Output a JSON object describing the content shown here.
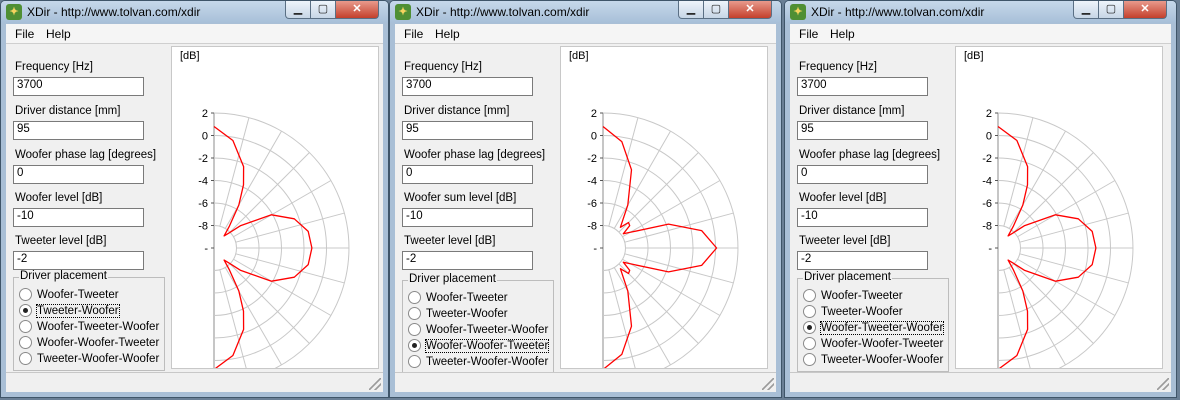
{
  "windows": [
    {
      "title": "XDir - http://www.tolvan.com/xdir",
      "menu": [
        "File",
        "Help"
      ],
      "fields": [
        {
          "label": "Frequency [Hz]",
          "value": "3700"
        },
        {
          "label": "Driver distance [mm]",
          "value": "95"
        },
        {
          "label": "Woofer phase lag [degrees]",
          "value": "0"
        },
        {
          "label": "Woofer level [dB]",
          "value": "-10"
        },
        {
          "label": "Tweeter level [dB]",
          "value": "-2"
        }
      ],
      "placement": {
        "label": "Driver placement",
        "options": [
          "Woofer-Tweeter",
          "Tweeter-Woofer",
          "Woofer-Tweeter-Woofer",
          "Woofer-Woofer-Tweeter",
          "Tweeter-Woofer-Woofer"
        ],
        "selected": 1
      },
      "chart_data": {
        "type": "line",
        "title": "",
        "ylabel": "[dB]",
        "radial_ticks": [
          "2",
          "0",
          "-2",
          "-4",
          "-6",
          "-8",
          "-"
        ],
        "r_range": [
          -10,
          2
        ],
        "angle_range_deg": [
          -90,
          90
        ],
        "grid": true,
        "series": [
          {
            "color": "#ff0000",
            "points": [
              [
                90,
                0.8
              ],
              [
                80,
                -0.3
              ],
              [
                70,
                -2.3
              ],
              [
                65,
                -3.8
              ],
              [
                60,
                -5.6
              ],
              [
                55,
                -7.6
              ],
              [
                50,
                -8.6
              ],
              [
                45,
                -8.1
              ],
              [
                40,
                -6.9
              ],
              [
                30,
                -4.1
              ],
              [
                20,
                -2.4
              ],
              [
                10,
                -1.5
              ],
              [
                0,
                -1.3
              ],
              [
                -10,
                -1.5
              ],
              [
                -20,
                -2.4
              ],
              [
                -30,
                -4.1
              ],
              [
                -40,
                -6.9
              ],
              [
                -45,
                -8.1
              ],
              [
                -50,
                -8.6
              ],
              [
                -55,
                -7.6
              ],
              [
                -60,
                -5.6
              ],
              [
                -65,
                -3.8
              ],
              [
                -70,
                -2.3
              ],
              [
                -80,
                -0.3
              ],
              [
                -90,
                0.8
              ]
            ]
          }
        ]
      }
    },
    {
      "title": "XDir - http://www.tolvan.com/xdir",
      "menu": [
        "File",
        "Help"
      ],
      "fields": [
        {
          "label": "Frequency [Hz]",
          "value": "3700"
        },
        {
          "label": "Driver distance [mm]",
          "value": "95"
        },
        {
          "label": "Woofer phase lag [degrees]",
          "value": "0"
        },
        {
          "label": "Woofer sum level [dB]",
          "value": "-10"
        },
        {
          "label": "Tweeter level [dB]",
          "value": "-2"
        }
      ],
      "placement": {
        "label": "Driver placement",
        "options": [
          "Woofer-Tweeter",
          "Tweeter-Woofer",
          "Woofer-Tweeter-Woofer",
          "Woofer-Woofer-Tweeter",
          "Tweeter-Woofer-Woofer"
        ],
        "selected": 3
      },
      "chart_data": {
        "type": "line",
        "title": "",
        "ylabel": "[dB]",
        "radial_ticks": [
          "2",
          "0",
          "-2",
          "-4",
          "-6",
          "-8",
          "-"
        ],
        "r_range": [
          -10,
          2
        ],
        "angle_range_deg": [
          -90,
          90
        ],
        "grid": true,
        "series": [
          {
            "color": "#ff0000",
            "points": [
              [
                90,
                0.8
              ],
              [
                80,
                -0.4
              ],
              [
                70,
                -2.6
              ],
              [
                60,
                -5.6
              ],
              [
                55,
                -6.9
              ],
              [
                50,
                -7.6
              ],
              [
                45,
                -6.8
              ],
              [
                40,
                -6.9
              ],
              [
                35,
                -7.8
              ],
              [
                30,
                -7.2
              ],
              [
                20,
                -3.8
              ],
              [
                10,
                -1.1
              ],
              [
                0,
                0.1
              ],
              [
                -10,
                -1.1
              ],
              [
                -20,
                -3.8
              ],
              [
                -30,
                -7.2
              ],
              [
                -35,
                -7.8
              ],
              [
                -40,
                -6.9
              ],
              [
                -45,
                -6.8
              ],
              [
                -50,
                -7.6
              ],
              [
                -55,
                -6.9
              ],
              [
                -60,
                -5.6
              ],
              [
                -70,
                -2.6
              ],
              [
                -80,
                -0.4
              ],
              [
                -90,
                0.8
              ]
            ]
          }
        ]
      }
    },
    {
      "title": "XDir - http://www.tolvan.com/xdir",
      "menu": [
        "File",
        "Help"
      ],
      "fields": [
        {
          "label": "Frequency [Hz]",
          "value": "3700"
        },
        {
          "label": "Driver distance [mm]",
          "value": "95"
        },
        {
          "label": "Woofer phase lag [degrees]",
          "value": "0"
        },
        {
          "label": "Woofer level [dB]",
          "value": "-10"
        },
        {
          "label": "Tweeter level [dB]",
          "value": "-2"
        }
      ],
      "placement": {
        "label": "Driver placement",
        "options": [
          "Woofer-Tweeter",
          "Tweeter-Woofer",
          "Woofer-Tweeter-Woofer",
          "Woofer-Woofer-Tweeter",
          "Tweeter-Woofer-Woofer"
        ],
        "selected": 2
      },
      "chart_data": {
        "type": "line",
        "title": "",
        "ylabel": "[dB]",
        "radial_ticks": [
          "2",
          "0",
          "-2",
          "-4",
          "-6",
          "-8",
          "-"
        ],
        "r_range": [
          -10,
          2
        ],
        "angle_range_deg": [
          -90,
          90
        ],
        "grid": true,
        "series": [
          {
            "color": "#ff0000",
            "points": [
              [
                90,
                0.8
              ],
              [
                80,
                -0.3
              ],
              [
                70,
                -2.3
              ],
              [
                65,
                -3.8
              ],
              [
                60,
                -5.6
              ],
              [
                55,
                -7.6
              ],
              [
                50,
                -8.6
              ],
              [
                45,
                -8.1
              ],
              [
                40,
                -6.9
              ],
              [
                30,
                -4.1
              ],
              [
                20,
                -2.4
              ],
              [
                10,
                -1.5
              ],
              [
                0,
                -1.3
              ],
              [
                -10,
                -1.5
              ],
              [
                -20,
                -2.4
              ],
              [
                -30,
                -4.1
              ],
              [
                -40,
                -6.9
              ],
              [
                -45,
                -8.1
              ],
              [
                -50,
                -8.6
              ],
              [
                -55,
                -7.6
              ],
              [
                -60,
                -5.6
              ],
              [
                -65,
                -3.8
              ],
              [
                -70,
                -2.3
              ],
              [
                -80,
                -0.3
              ],
              [
                -90,
                0.8
              ]
            ]
          }
        ]
      }
    }
  ]
}
